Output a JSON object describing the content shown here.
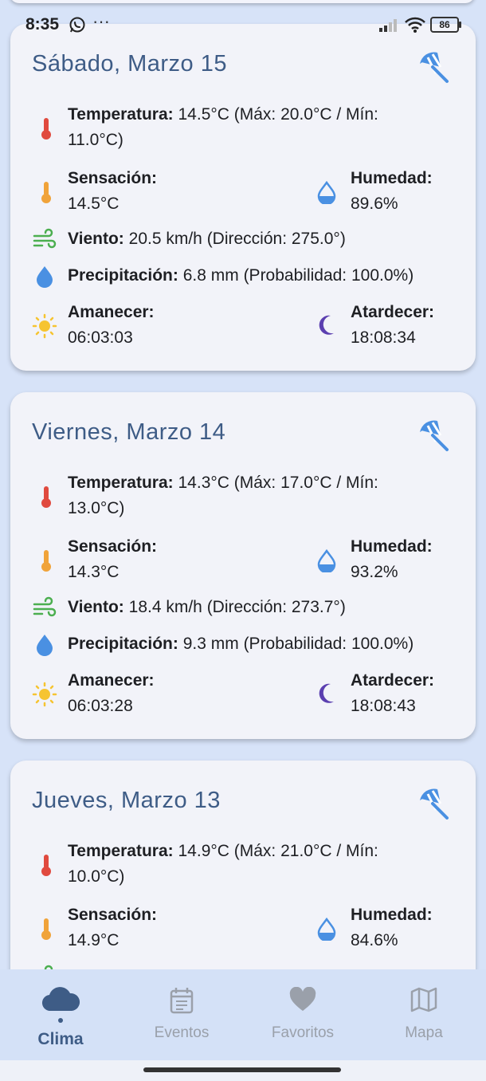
{
  "status": {
    "time": "8:35",
    "more": "···",
    "battery": "86"
  },
  "days": [
    {
      "title": "Sábado, Marzo 15",
      "temp_label": "Temperatura:",
      "temp_value": "14.5°C (Máx: 20.0°C / Mín:",
      "temp_value2": "11.0°C)",
      "feels_label": "Sensación:",
      "feels_value": "14.5°C",
      "humidity_label": "Humedad:",
      "humidity_value": "89.6%",
      "wind_label": "Viento:",
      "wind_value": "20.5 km/h (Dirección: 275.0°)",
      "precip_label": "Precipitación:",
      "precip_value": "6.8 mm (Probabilidad: 100.0%)",
      "sunrise_label": "Amanecer:",
      "sunrise_value": "06:03:03",
      "sunset_label": "Atardecer:",
      "sunset_value": "18:08:34"
    },
    {
      "title": "Viernes, Marzo 14",
      "temp_label": "Temperatura:",
      "temp_value": "14.3°C (Máx: 17.0°C / Mín:",
      "temp_value2": "13.0°C)",
      "feels_label": "Sensación:",
      "feels_value": "14.3°C",
      "humidity_label": "Humedad:",
      "humidity_value": "93.2%",
      "wind_label": "Viento:",
      "wind_value": "18.4 km/h (Dirección: 273.7°)",
      "precip_label": "Precipitación:",
      "precip_value": "9.3 mm (Probabilidad: 100.0%)",
      "sunrise_label": "Amanecer:",
      "sunrise_value": "06:03:28",
      "sunset_label": "Atardecer:",
      "sunset_value": "18:08:43"
    },
    {
      "title": "Jueves, Marzo 13",
      "temp_label": "Temperatura:",
      "temp_value": "14.9°C (Máx: 21.0°C / Mín:",
      "temp_value2": "10.0°C)",
      "feels_label": "Sensación:",
      "feels_value": "14.9°C",
      "humidity_label": "Humedad:",
      "humidity_value": "84.6%"
    }
  ],
  "nav": {
    "items": [
      {
        "label": "Clima",
        "icon": "cloud-icon"
      },
      {
        "label": "Eventos",
        "icon": "calendar-icon"
      },
      {
        "label": "Favoritos",
        "icon": "heart-icon"
      },
      {
        "label": "Mapa",
        "icon": "map-icon"
      }
    ],
    "active": "Clima"
  },
  "colors": {
    "background": "#d7e3f8",
    "card": "#f2f3f9",
    "title": "#3e5c86",
    "accent_blue": "#4a90e2",
    "temp_red": "#e04a3f",
    "orange": "#f0a33a",
    "wind_green": "#4caf50",
    "sun_yellow": "#f6c431",
    "moon_purple": "#5b3fb0"
  }
}
